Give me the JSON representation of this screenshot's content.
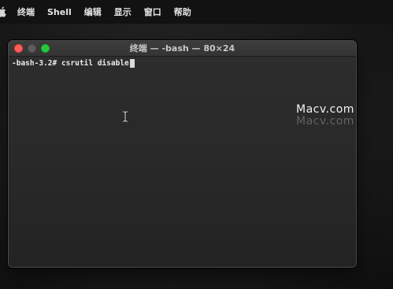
{
  "menubar": {
    "apple_icon": "apple-icon",
    "items": [
      "终端",
      "Shell",
      "编辑",
      "显示",
      "窗口",
      "帮助"
    ]
  },
  "window": {
    "title": "终端 — -bash — 80×24",
    "traffic_lights": {
      "close_color": "#ff5f57",
      "minimize_color": "#5e5e5e",
      "zoom_color": "#28c840"
    }
  },
  "terminal": {
    "prompt": "-bash-3.2#",
    "command": "csrutil disable"
  },
  "watermark": {
    "text": "Macv.com",
    "shadow_text": "Macv.com"
  }
}
